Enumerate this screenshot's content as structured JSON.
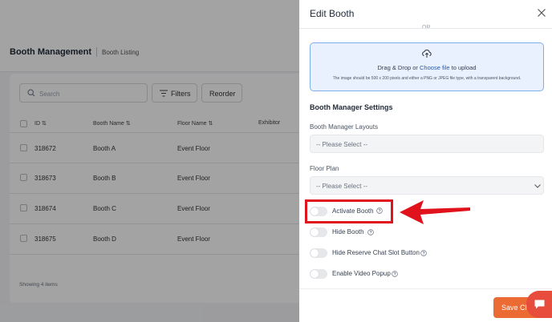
{
  "background": {
    "header": {
      "title": "Booth Management",
      "breadcrumb": "Booth Listing"
    },
    "toolbar": {
      "search_placeholder": "Search",
      "filters_label": "Filters",
      "reorder_label": "Reorder"
    },
    "table": {
      "columns": [
        "ID",
        "Booth Name",
        "Floor Name",
        "Exhibitor"
      ],
      "rows": [
        {
          "id": "318672",
          "name": "Booth A",
          "floor": "Event Floor"
        },
        {
          "id": "318673",
          "name": "Booth B",
          "floor": "Event Floor"
        },
        {
          "id": "318674",
          "name": "Booth C",
          "floor": "Event Floor"
        },
        {
          "id": "318675",
          "name": "Booth D",
          "floor": "Event Floor"
        }
      ]
    },
    "footer": "Showing 4 items"
  },
  "drawer": {
    "title": "Edit Booth",
    "or_text": "OR",
    "upload": {
      "prefix": "Drag & Drop or ",
      "link": "Choose file",
      "suffix": " to upload",
      "hint": "The image should be 500 x 200 pixels and either a PNG or JPEG file type, with a transparent background."
    },
    "section_title": "Booth Manager Settings",
    "layouts": {
      "label": "Booth Manager Layouts",
      "placeholder": "-- Please Select --"
    },
    "floor_plan": {
      "label": "Floor Plan",
      "placeholder": "-- Please Select --"
    },
    "toggles": [
      {
        "label": "Activate Booth",
        "checked": false,
        "help": true
      },
      {
        "label": "Hide Booth",
        "checked": false,
        "help": true
      },
      {
        "label": "Hide Reserve Chat Slot Button",
        "checked": false,
        "help": true
      },
      {
        "label": "Enable Video Popup",
        "checked": false,
        "help": true
      }
    ],
    "save_label": "Save Ch"
  },
  "colors": {
    "accent": "#ec6a33",
    "upload_bg": "#e8f1fd",
    "upload_border": "#7eaee8",
    "annotation": "#e0121c",
    "chat": "#e74c3c"
  }
}
